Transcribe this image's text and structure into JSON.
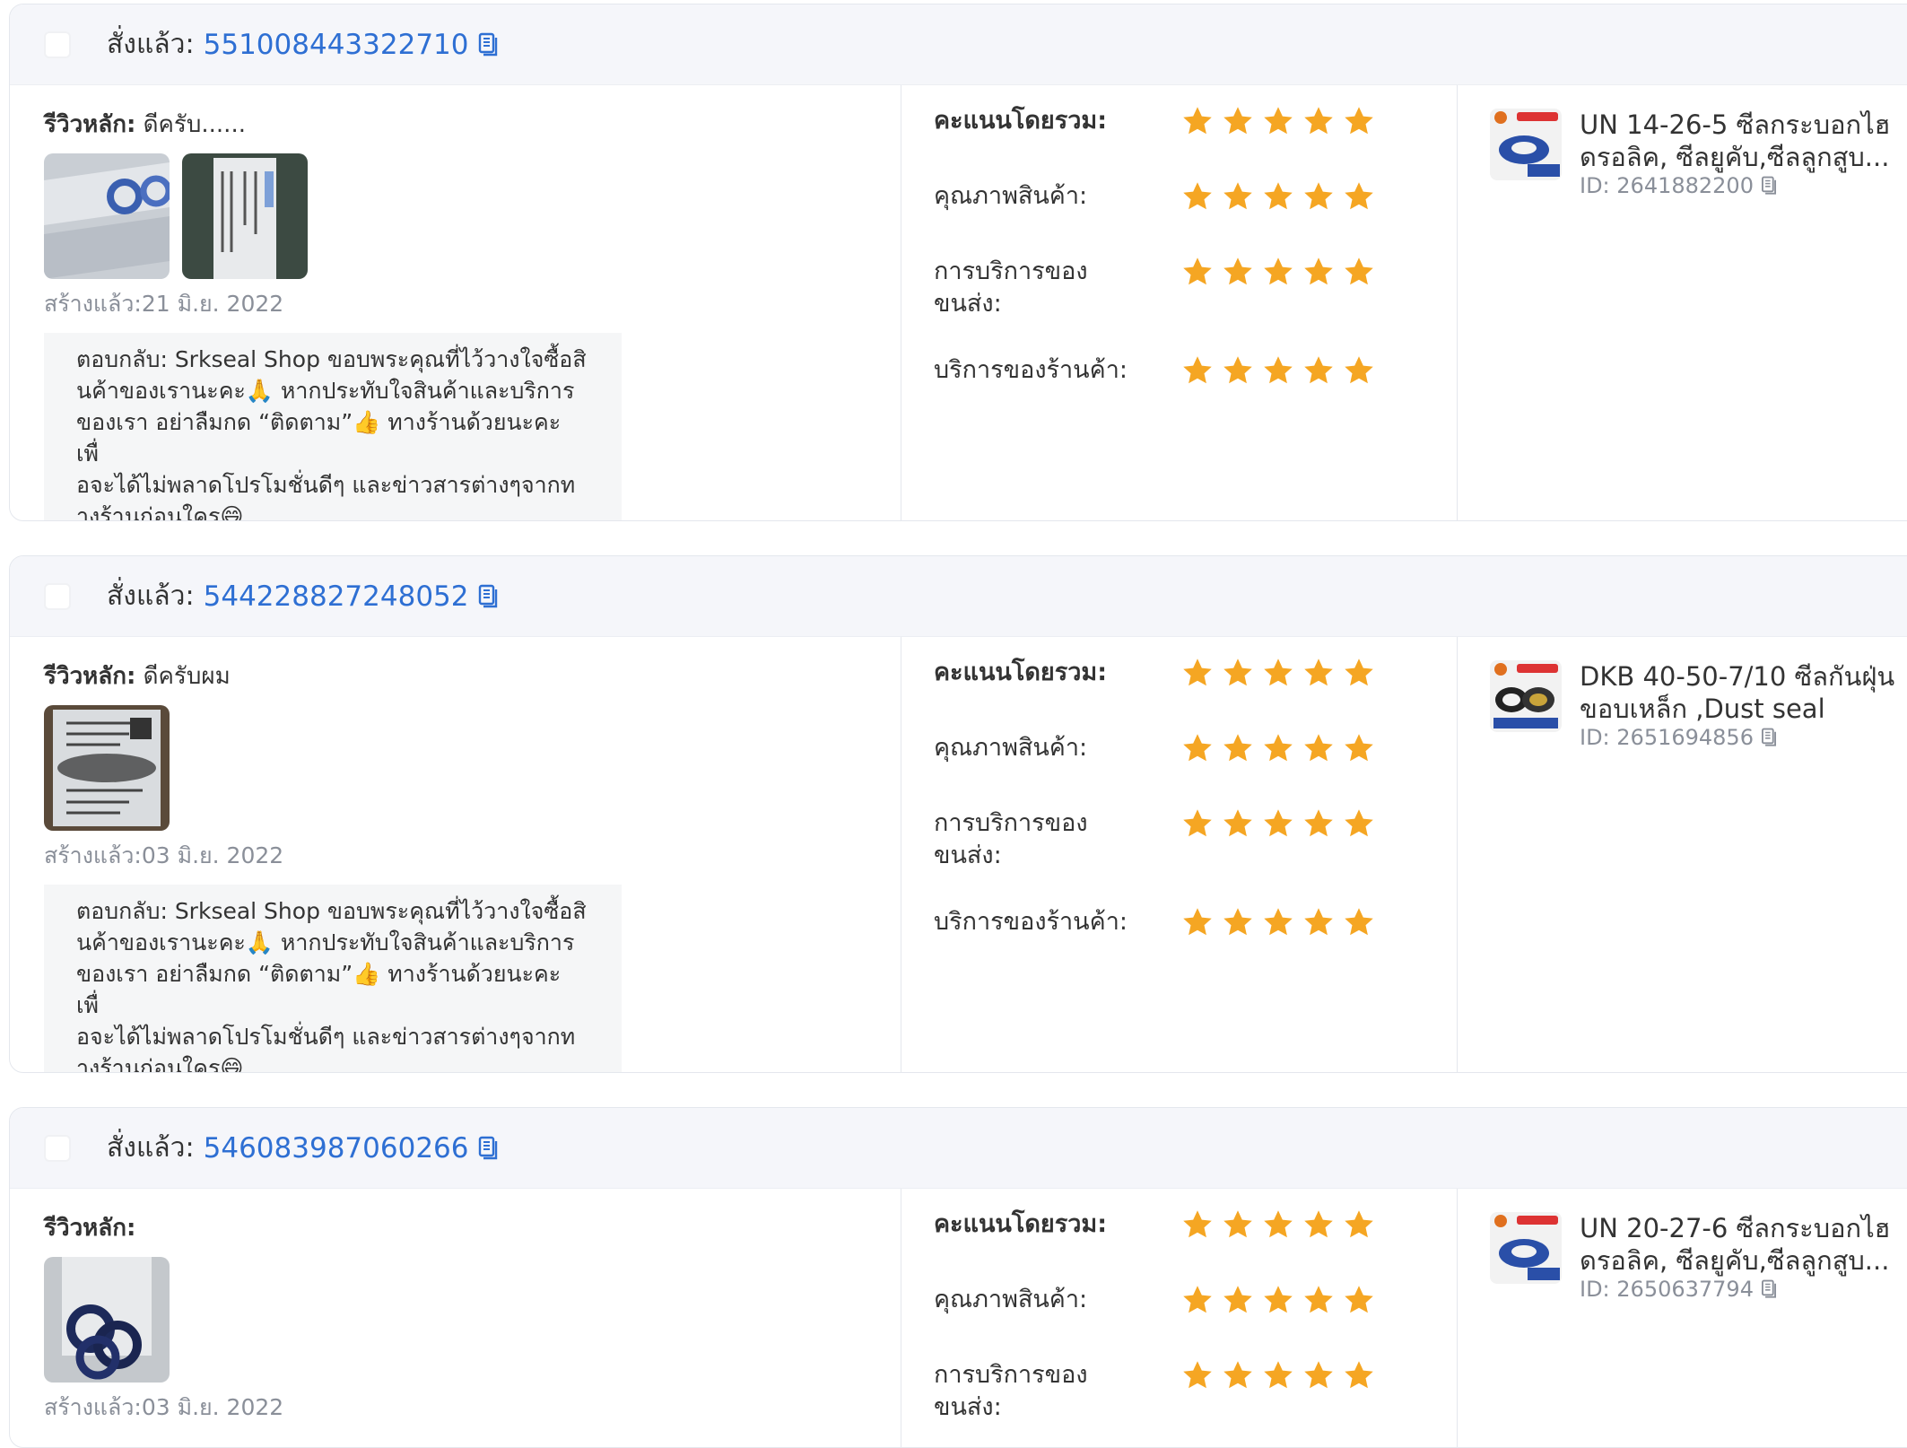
{
  "reviews": [
    {
      "order_label": "สั่งแล้ว:",
      "order_id": "551008443322710",
      "review_label": "รีวิวหลัก:",
      "review_text": "ดีครับ......",
      "created": "สร้างแล้ว:21 มิ.ย. 2022",
      "reply_lines": [
        "ตอบกลับ: Srkseal Shop ขอบพระคุณที่ไว้วางใจซื้อสิ",
        "นค้าของเรานะคะ🙏 หากประทับใจสินค้าและบริการ",
        "ของเรา อย่าลืมกด “ติดตาม”👍 ทางร้านด้วยนะคะ เพื่",
        "อจะได้ไม่พลาดโปรโมชั่นดีๆ และข่าวสารต่างๆจากท",
        "างร้านก่อนใคร😄"
      ],
      "ratings": [
        {
          "label": "คะแนนโดยรวม:",
          "stars": 5
        },
        {
          "label": "คุณภาพสินค้า:",
          "stars": 5
        },
        {
          "label": "การบริการของขนส่ง:",
          "stars": 5
        },
        {
          "label": "บริการของร้านค้า:",
          "stars": 5
        }
      ],
      "product_title": "UN 14-26-5 ซีลกระบอกไฮดรอลิค, ซีลยูคับ,ซีลลูกสูบ...",
      "product_id": "ID: 2641882200"
    },
    {
      "order_label": "สั่งแล้ว:",
      "order_id": "544228827248052",
      "review_label": "รีวิวหลัก:",
      "review_text": "ดีครับผม",
      "created": "สร้างแล้ว:03 มิ.ย. 2022",
      "reply_lines": [
        "ตอบกลับ: Srkseal Shop ขอบพระคุณที่ไว้วางใจซื้อสิ",
        "นค้าของเรานะคะ🙏 หากประทับใจสินค้าและบริการ",
        "ของเรา อย่าลืมกด “ติดตาม”👍 ทางร้านด้วยนะคะ เพื่",
        "อจะได้ไม่พลาดโปรโมชั่นดีๆ และข่าวสารต่างๆจากท",
        "างร้านก่อนใคร😄"
      ],
      "ratings": [
        {
          "label": "คะแนนโดยรวม:",
          "stars": 5
        },
        {
          "label": "คุณภาพสินค้า:",
          "stars": 5
        },
        {
          "label": "การบริการของขนส่ง:",
          "stars": 5
        },
        {
          "label": "บริการของร้านค้า:",
          "stars": 5
        }
      ],
      "product_title": "DKB 40-50-7/10 ซีลกันฝุ่นขอบเหล็ก ,Dust seal",
      "product_id": "ID: 2651694856"
    },
    {
      "order_label": "สั่งแล้ว:",
      "order_id": "546083987060266",
      "review_label": "รีวิวหลัก:",
      "review_text": "",
      "created": "สร้างแล้ว:03 มิ.ย. 2022",
      "reply_lines": [],
      "ratings": [
        {
          "label": "คะแนนโดยรวม:",
          "stars": 5
        },
        {
          "label": "คุณภาพสินค้า:",
          "stars": 5
        },
        {
          "label": "การบริการของขนส่ง:",
          "stars": 5
        }
      ],
      "product_title": "UN 20-27-6 ซีลกระบอกไฮดรอลิค, ซีลยูคับ,ซีลลูกสูบ...",
      "product_id": "ID: 2650637794"
    }
  ],
  "colors": {
    "link": "#2e6fd3",
    "star": "#f5a623",
    "header_bg": "#f5f6fa",
    "reply_bg": "#f5f6f7"
  }
}
